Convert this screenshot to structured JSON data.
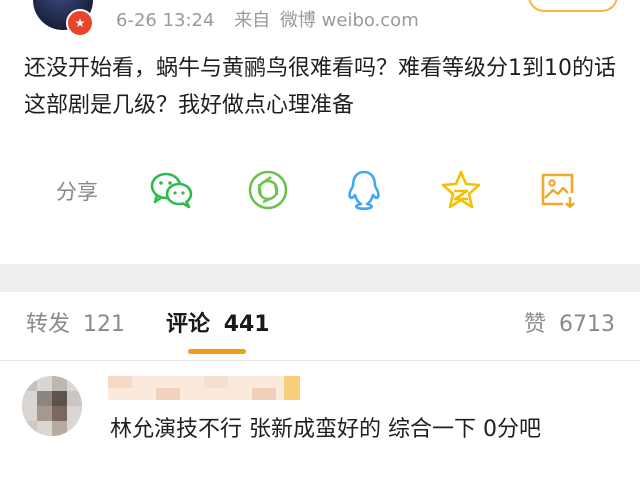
{
  "post": {
    "timestamp": "6-26 13:24",
    "source_prefix": "来自",
    "source": "微博 weibo.com",
    "text": "还没开始看，蜗牛与黄鹂鸟很难看吗？难看等级分1到10的话这部剧是几级？我好做点心理准备"
  },
  "actions": {
    "share_label": "分享",
    "icons": [
      "wechat-icon",
      "moments-icon",
      "qq-icon",
      "qzone-icon",
      "save-image-icon"
    ],
    "colors": {
      "wechat": "#2dbb4e",
      "moments": "#6cc24a",
      "qq": "#3fa9f5",
      "qzone": "#f2c200",
      "save": "#f0a72a"
    }
  },
  "tabs": {
    "repost_label": "转发",
    "repost_count": "121",
    "comment_label": "评论",
    "comment_count": "441",
    "like_label": "赞",
    "like_count": "6713",
    "accent_color": "#f39b1f"
  },
  "comment": {
    "text": "林允演技不行 张新成蛮好的 综合一下 0分吧"
  }
}
